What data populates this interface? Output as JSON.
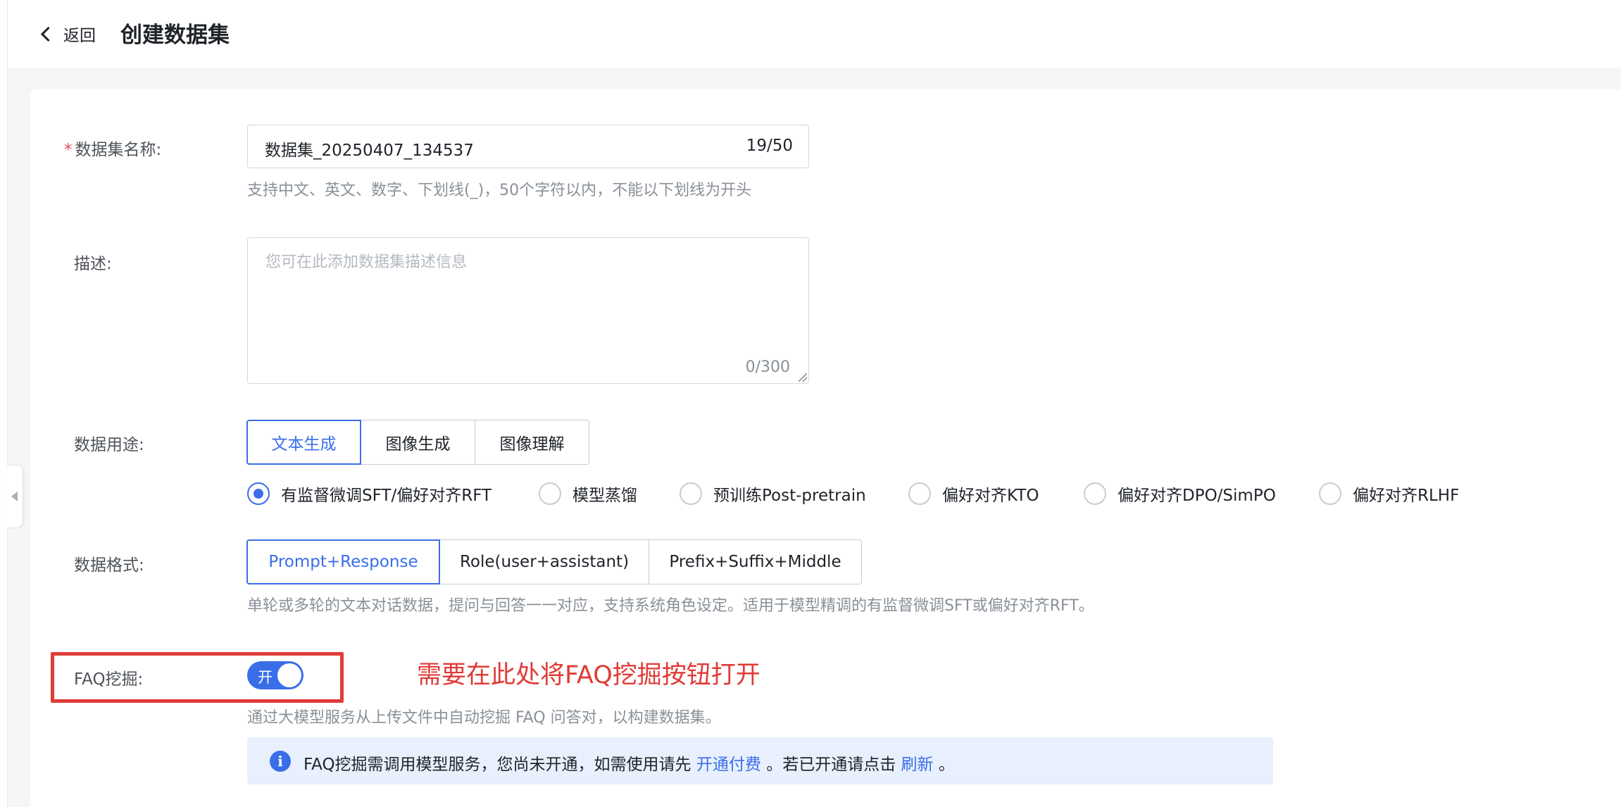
{
  "header": {
    "back_label": "返回",
    "title": "创建数据集"
  },
  "form": {
    "name": {
      "required_mark": "*",
      "label": "数据集名称:",
      "value": "数据集_20250407_134537",
      "count": "19/50",
      "hint": "支持中文、英文、数字、下划线(_)，50个字符以内，不能以下划线为开头"
    },
    "description": {
      "label": "描述:",
      "placeholder": "您可在此添加数据集描述信息",
      "count": "0/300"
    },
    "usage": {
      "label": "数据用途:",
      "tabs": [
        {
          "label": "文本生成",
          "active": true
        },
        {
          "label": "图像生成",
          "active": false
        },
        {
          "label": "图像理解",
          "active": false
        }
      ],
      "radios": [
        {
          "label": "有监督微调SFT/偏好对齐RFT",
          "checked": true
        },
        {
          "label": "模型蒸馏",
          "checked": false
        },
        {
          "label": "预训练Post-pretrain",
          "checked": false
        },
        {
          "label": "偏好对齐KTO",
          "checked": false
        },
        {
          "label": "偏好对齐DPO/SimPO",
          "checked": false
        },
        {
          "label": "偏好对齐RLHF",
          "checked": false
        }
      ]
    },
    "format": {
      "label": "数据格式:",
      "tabs": [
        {
          "label": "Prompt+Response",
          "active": true
        },
        {
          "label": "Role(user+assistant)",
          "active": false
        },
        {
          "label": "Prefix+Suffix+Middle",
          "active": false
        }
      ],
      "hint": "单轮或多轮的文本对话数据，提问与回答一一对应，支持系统角色设定。适用于模型精调的有监督微调SFT或偏好对齐RFT。"
    },
    "faq": {
      "label": "FAQ挖掘:",
      "toggle_text": "开",
      "toggle_on": true,
      "annotation": "需要在此处将FAQ挖掘按钮打开",
      "hint": "通过大模型服务从上传文件中自动挖掘 FAQ 问答对，以构建数据集。",
      "info": {
        "icon": "i",
        "text_before": "FAQ挖掘需调用模型服务，您尚未开通，如需使用请先",
        "link_activate": "开通付费",
        "text_middle": "。若已开通请点击",
        "link_refresh": "刷新",
        "text_after": "。"
      }
    }
  },
  "colors": {
    "primary": "#3a6ee8",
    "annotation_red": "#e03b36"
  }
}
